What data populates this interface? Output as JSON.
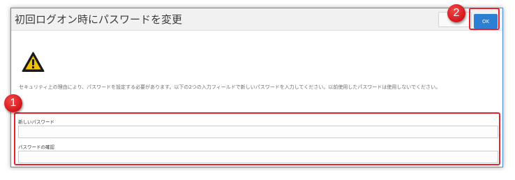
{
  "dialog": {
    "title": "初回ログオン時にパスワードを変更",
    "ok_label": "OK",
    "message": "セキュリティ上の理由により、パスワードを設定する必要があります。以下の2つの入力フィールドで新しいパスワードを入力してください。以前使用したパスワードは使用しないでください。",
    "fields": [
      {
        "label": "新しいパスワード",
        "value": ""
      },
      {
        "label": "パスワードの確認",
        "value": ""
      }
    ],
    "warning_icon": "warning-triangle-icon"
  },
  "callouts": {
    "one": "1",
    "two": "2"
  },
  "colors": {
    "accent": "#2d7fd3",
    "callout": "#e5222d",
    "border": "#4a8fd8"
  }
}
